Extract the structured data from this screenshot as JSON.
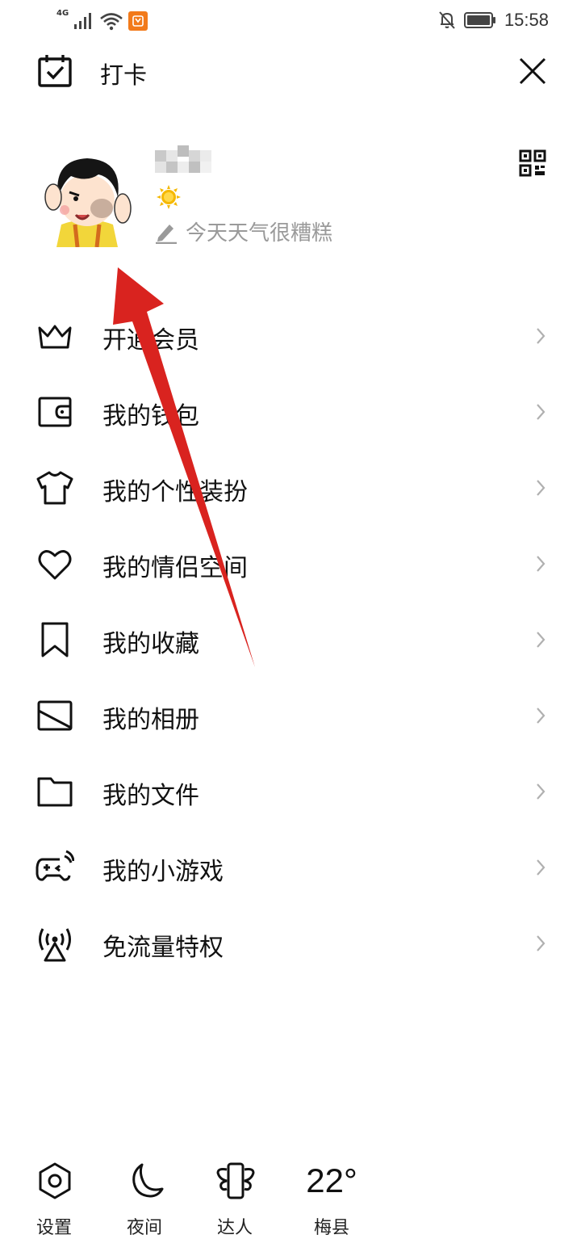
{
  "status_bar": {
    "network_label": "4G",
    "time": "15:58",
    "icons": [
      "signal-icon",
      "wifi-icon",
      "app-notification-icon",
      "mute-bell-icon",
      "battery-icon"
    ]
  },
  "header": {
    "checkin_label": "打卡",
    "icons": [
      "calendar-check-icon",
      "close-icon"
    ]
  },
  "profile": {
    "nickname_blurred": true,
    "signature": "今天天气很糟糕",
    "icons": [
      "avatar",
      "sun-level-icon",
      "pencil-icon",
      "qr-code-icon"
    ]
  },
  "menu": {
    "items": [
      {
        "label": "开通会员",
        "icon": "crown-icon"
      },
      {
        "label": "我的钱包",
        "icon": "wallet-icon"
      },
      {
        "label": "我的个性装扮",
        "icon": "tshirt-icon"
      },
      {
        "label": "我的情侣空间",
        "icon": "heart-icon"
      },
      {
        "label": "我的收藏",
        "icon": "bookmark-icon"
      },
      {
        "label": "我的相册",
        "icon": "photo-album-icon"
      },
      {
        "label": "我的文件",
        "icon": "folder-icon"
      },
      {
        "label": "我的小游戏",
        "icon": "gamepad-icon"
      },
      {
        "label": "免流量特权",
        "icon": "signal-tower-icon"
      }
    ]
  },
  "bottom_bar": {
    "settings_label": "设置",
    "night_label": "夜间",
    "expert_label": "达人",
    "temperature": "22°",
    "city": "梅县",
    "icons": [
      "settings-hexagon-icon",
      "moon-icon",
      "phone-wings-icon"
    ]
  },
  "annotation": {
    "arrow_color": "#d9231f"
  }
}
